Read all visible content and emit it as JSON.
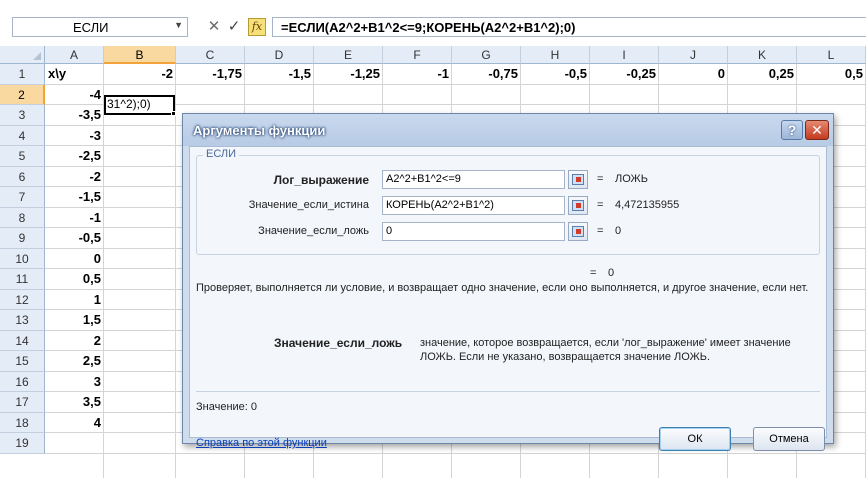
{
  "formula_bar": {
    "name_box": "ЕСЛИ",
    "cancel_glyph": "✕",
    "enter_glyph": "✓",
    "fx_label": "fx",
    "formula": "=ЕСЛИ(A2^2+B1^2<=9;КОРЕНЬ(A2^2+B1^2);0)"
  },
  "columns": [
    "A",
    "B",
    "C",
    "D",
    "E",
    "F",
    "G",
    "H",
    "I",
    "J",
    "K",
    "L"
  ],
  "selected_column": "B",
  "rows": [
    "1",
    "2",
    "3",
    "4",
    "5",
    "6",
    "7",
    "8",
    "9",
    "10",
    "11",
    "12",
    "13",
    "14",
    "15",
    "16",
    "17",
    "18",
    "19"
  ],
  "selected_row": "2",
  "row1": [
    "x\\y",
    "-2",
    "-1,75",
    "-1,5",
    "-1,25",
    "-1",
    "-0,75",
    "-0,5",
    "-0,25",
    "0",
    "0,25",
    "0,5"
  ],
  "colA": [
    "-4",
    "-3,5",
    "-3",
    "-2,5",
    "-2",
    "-1,5",
    "-1",
    "-0,5",
    "0",
    "0,5",
    "1",
    "1,5",
    "2",
    "2,5",
    "3",
    "3,5",
    "4"
  ],
  "edit_cell_text": "31^2);0)",
  "dialog": {
    "title": "Аргументы функции",
    "help_glyph": "?",
    "close_glyph": "✕",
    "group_label": "ЕСЛИ",
    "args": [
      {
        "label": "Лог_выражение",
        "value": "A2^2+B1^2<=9",
        "eq": "=",
        "result": "ЛОЖЬ"
      },
      {
        "label": "Значение_если_истина",
        "value": "КОРЕНЬ(A2^2+B1^2)",
        "eq": "=",
        "result": "4,472135955"
      },
      {
        "label": "Значение_если_ложь",
        "value": "0",
        "eq": "=",
        "result": "0"
      }
    ],
    "overall_eq": "=",
    "overall_result": "0",
    "description": "Проверяет, выполняется ли условие, и возвращает одно значение, если оно выполняется, и другое значение, если нет.",
    "param_name": "Значение_если_ложь",
    "param_desc": "значение, которое возвращается, если 'лог_выражение' имеет значение ЛОЖЬ. Если не указано, возвращается значение ЛОЖЬ.",
    "result_line": "Значение:  0",
    "help_link": "Справка по этой функции",
    "ok": "ОК",
    "cancel": "Отмена"
  }
}
